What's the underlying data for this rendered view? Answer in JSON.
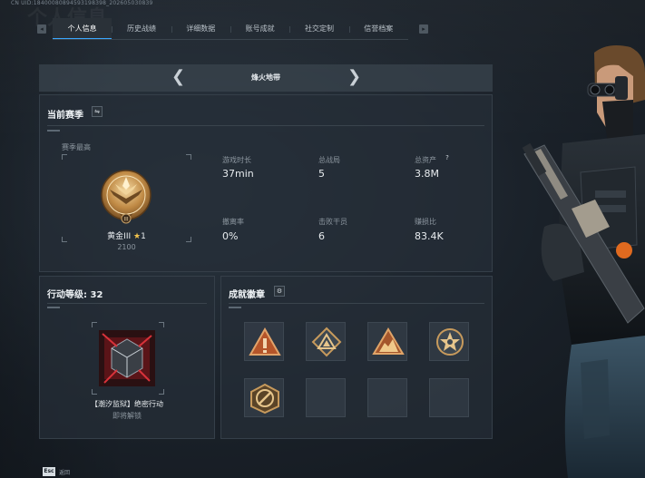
{
  "header": {
    "uid": "CN UID:18400080894593198398_202605030839",
    "faint_title": "个人信息"
  },
  "tabs": [
    {
      "label": "个人信息",
      "active": true
    },
    {
      "label": "历史战绩",
      "active": false
    },
    {
      "label": "详细数据",
      "active": false
    },
    {
      "label": "账号成就",
      "active": false
    },
    {
      "label": "社交定制",
      "active": false
    },
    {
      "label": "信誉档案",
      "active": false
    }
  ],
  "map": {
    "name": "烽火地带"
  },
  "season": {
    "title": "当前赛季",
    "season_high_label": "赛季最高",
    "rank_name": "黄金III",
    "rank_stars": "1",
    "rank_score": "2100",
    "stats": [
      {
        "label": "游戏时长",
        "value": "37min"
      },
      {
        "label": "总战局",
        "value": "5"
      },
      {
        "label": "总资产",
        "value": "3.8M",
        "help": "?"
      },
      {
        "label": "撤离率",
        "value": "0%"
      },
      {
        "label": "击败干员",
        "value": "6"
      },
      {
        "label": "赚损比",
        "value": "83.4K"
      }
    ]
  },
  "action_level": {
    "title": "行动等级: 32",
    "operation_name": "【潮汐监狱】绝密行动",
    "operation_status": "即将解锁"
  },
  "achievements": {
    "title": "成就徽章",
    "badges": [
      {
        "icon": "warning-triangle-badge-icon",
        "filled": true
      },
      {
        "icon": "pyramid-badge-icon",
        "filled": true
      },
      {
        "icon": "mountain-badge-icon",
        "filled": true
      },
      {
        "icon": "star-target-badge-icon",
        "filled": true
      },
      {
        "icon": "slash-circle-badge-icon",
        "filled": true
      },
      {
        "icon": "empty-slot",
        "filled": false
      },
      {
        "icon": "empty-slot",
        "filled": false
      },
      {
        "icon": "empty-slot",
        "filled": false
      }
    ]
  },
  "footer": {
    "key_label": "Esc",
    "action_label": "返回"
  }
}
